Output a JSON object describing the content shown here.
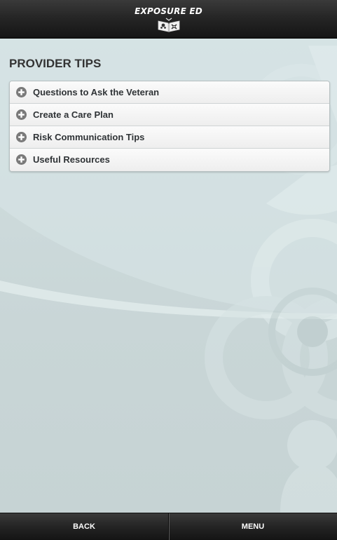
{
  "header": {
    "app_name": "EXPOSURE ED",
    "logo_icon": "open-book-icon"
  },
  "main": {
    "title": "PROVIDER TIPS",
    "accordion": [
      {
        "label": "Questions to Ask the Veteran",
        "icon": "plus-circle-icon"
      },
      {
        "label": "Create a Care Plan",
        "icon": "plus-circle-icon"
      },
      {
        "label": "Risk Communication Tips",
        "icon": "plus-circle-icon"
      },
      {
        "label": "Useful Resources",
        "icon": "plus-circle-icon"
      }
    ],
    "background_art": "biohazard-radiation-watermark"
  },
  "footer": {
    "back_label": "BACK",
    "menu_label": "MENU"
  },
  "colors": {
    "header_bg": "#262626",
    "content_bg": "#c9d7d8",
    "accordion_bg": "#f6f6f6",
    "icon_color": "#7a7a7a",
    "title_text": "#333333"
  }
}
